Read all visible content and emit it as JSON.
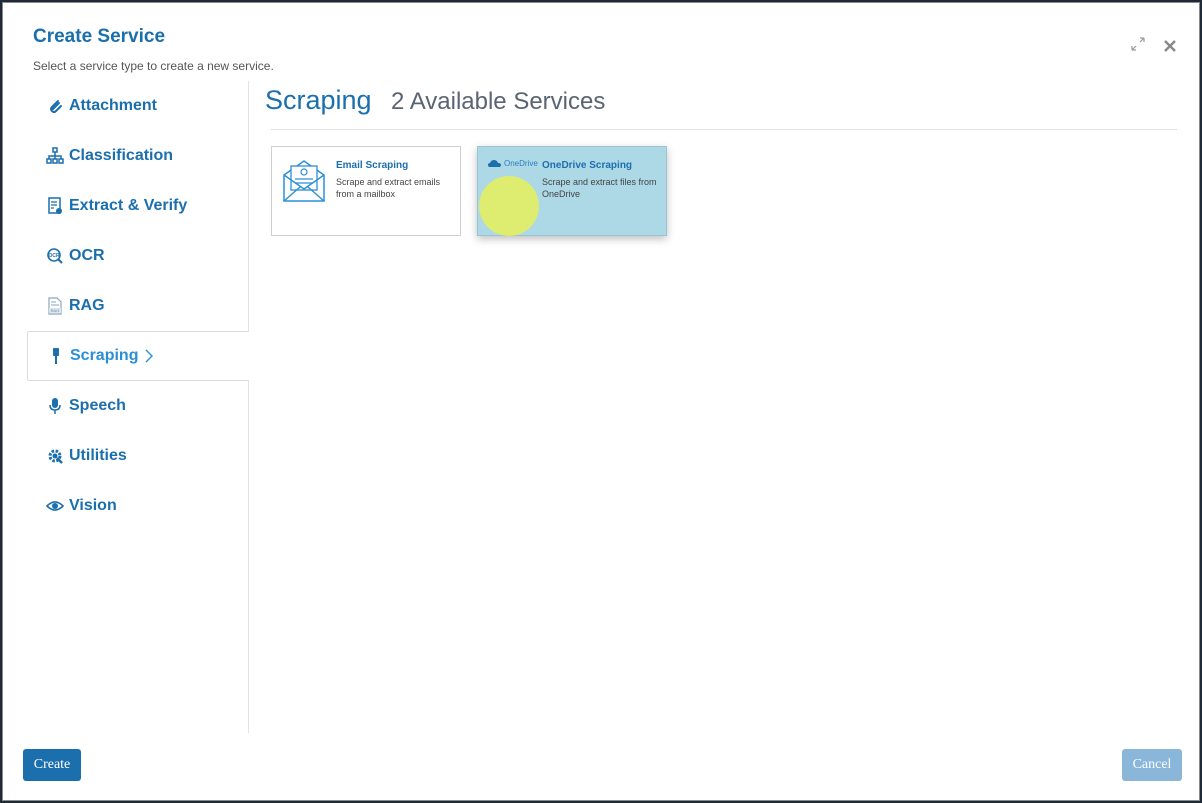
{
  "dialog": {
    "title": "Create Service",
    "subtitle": "Select a service type to create a new service."
  },
  "sidebar": {
    "items": [
      {
        "label": "Attachment",
        "icon": "paperclip-icon"
      },
      {
        "label": "Classification",
        "icon": "hierarchy-icon"
      },
      {
        "label": "Extract & Verify",
        "icon": "document-check-icon"
      },
      {
        "label": "OCR",
        "icon": "ocr-search-icon"
      },
      {
        "label": "RAG",
        "icon": "rag-document-icon"
      },
      {
        "label": "Scraping",
        "icon": "scraper-icon",
        "active": true
      },
      {
        "label": "Speech",
        "icon": "microphone-icon"
      },
      {
        "label": "Utilities",
        "icon": "gear-wrench-icon"
      },
      {
        "label": "Vision",
        "icon": "eye-icon"
      }
    ]
  },
  "content": {
    "title": "Scraping",
    "count_label": "2 Available Services",
    "cards": [
      {
        "title": "Email Scraping",
        "description": "Scrape and extract emails from a mailbox",
        "icon": "email-envelope-icon"
      },
      {
        "title": "OneDrive Scraping",
        "description": "Scrape and extract files from OneDrive",
        "icon": "onedrive-logo",
        "logo_text": "OneDrive"
      }
    ]
  },
  "footer": {
    "create_label": "Create",
    "cancel_label": "Cancel"
  },
  "colors": {
    "accent": "#1b6fad",
    "hover_card": "#add8e6",
    "cancel_disabled": "#8ab7d9"
  }
}
